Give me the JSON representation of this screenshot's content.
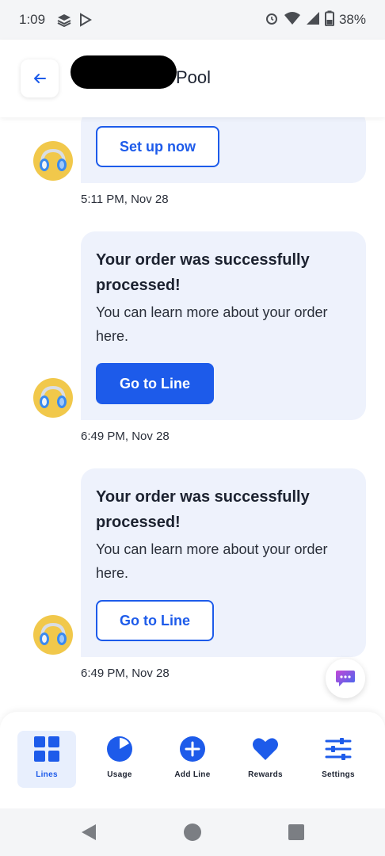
{
  "status_bar": {
    "time": "1:09",
    "battery": "38%"
  },
  "header": {
    "title": "Pool"
  },
  "messages": {
    "m0": {
      "button": "Set up now",
      "timestamp": "5:11 PM, Nov 28"
    },
    "m1": {
      "title": "Your order was successfully processed!",
      "body": "You can learn more about your order here.",
      "button": "Go to Line",
      "timestamp": "6:49 PM, Nov 28"
    },
    "m2": {
      "title": "Your order was successfully processed!",
      "body": "You can learn more about your order here.",
      "button": "Go to Line",
      "timestamp": "6:49 PM, Nov 28"
    }
  },
  "tabs": {
    "lines": "Lines",
    "usage": "Usage",
    "add_line": "Add Line",
    "rewards": "Rewards",
    "settings": "Settings"
  },
  "colors": {
    "accent": "#1d5bea",
    "bubble": "#eef2fc",
    "avatar": "#f1c84b"
  }
}
